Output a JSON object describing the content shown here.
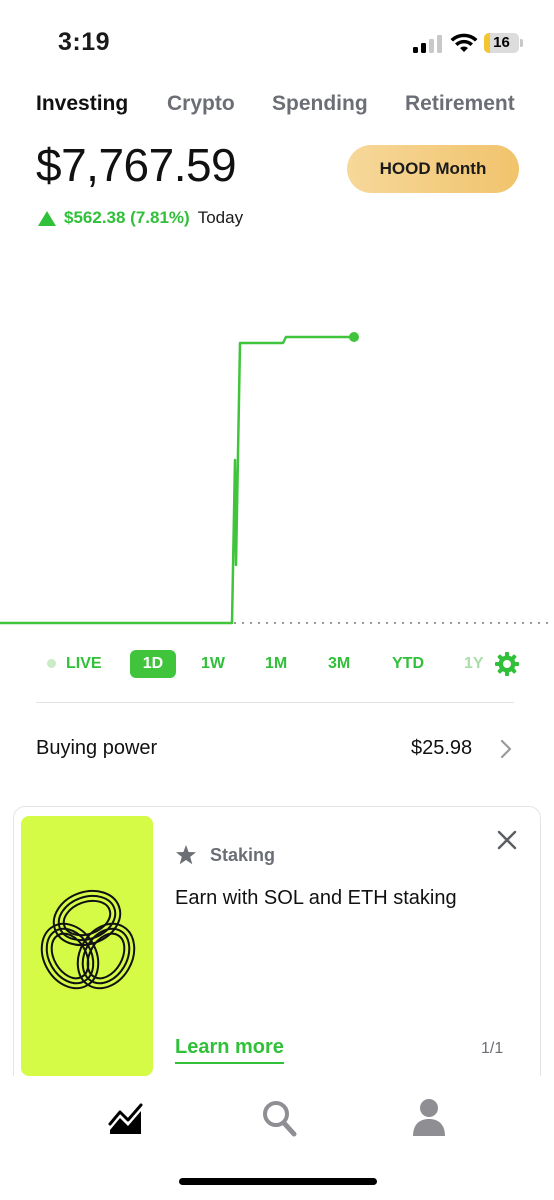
{
  "status_bar": {
    "time": "3:19",
    "battery": "16",
    "battery_level": 0.16,
    "icons": [
      "signal-icon",
      "wifi-icon",
      "battery-icon"
    ]
  },
  "tabs": [
    {
      "label": "Investing",
      "active": true
    },
    {
      "label": "Crypto",
      "active": false
    },
    {
      "label": "Spending",
      "active": false
    },
    {
      "label": "Retirement",
      "active": false
    }
  ],
  "portfolio": {
    "balance": "$7,767.59",
    "promo_button": "HOOD Month",
    "change_value": "$562.38 (7.81%)",
    "change_period": "Today"
  },
  "ranges": [
    {
      "label": "LIVE",
      "selected": false
    },
    {
      "label": "1D",
      "selected": true
    },
    {
      "label": "1W",
      "selected": false
    },
    {
      "label": "1M",
      "selected": false
    },
    {
      "label": "3M",
      "selected": false
    },
    {
      "label": "YTD",
      "selected": false
    },
    {
      "label": "1Y",
      "selected": false
    }
  ],
  "buying_power": {
    "label": "Buying power",
    "value": "$25.98"
  },
  "promo_card": {
    "tag": "Staking",
    "title": "Earn with SOL and ETH staking",
    "link": "Learn more",
    "page": "1/1"
  },
  "bottom_nav": [
    "chart-icon",
    "search-icon",
    "account-icon"
  ],
  "colors": {
    "accent_green": "#31c03a",
    "promo_gold": "#f1c36c",
    "card_lime": "#d5fb46"
  }
}
